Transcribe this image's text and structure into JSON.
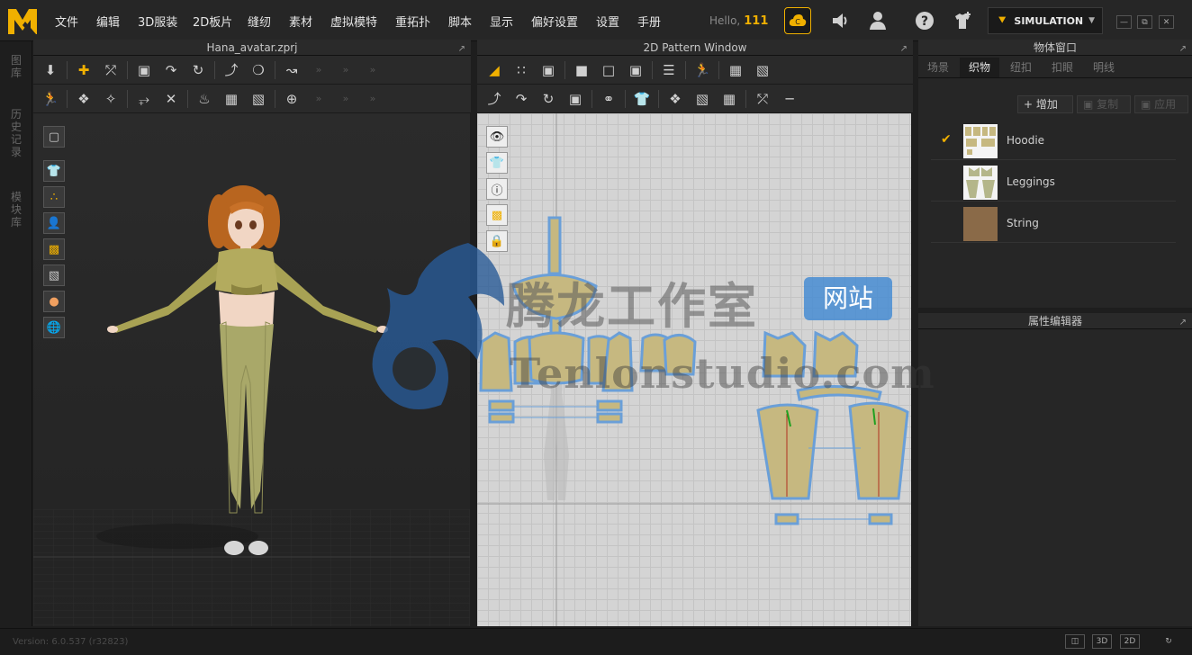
{
  "menubar": {
    "items": [
      "文件",
      "编辑",
      "3D服装",
      "2D板片",
      "缝纫",
      "素材",
      "虚拟模特",
      "重拓扑",
      "脚本",
      "显示",
      "偏好设置",
      "设置",
      "手册"
    ],
    "hello_label": "Hello,",
    "user_points": "111",
    "mode_label": "SIMULATION"
  },
  "side_tabs": [
    "图库",
    "历史记录",
    "模块库"
  ],
  "panels": {
    "view3d_title": "Hana_avatar.zprj",
    "view2d_title": "2D Pattern Window",
    "object_window_title": "物体窗口",
    "property_editor_title": "属性编辑器"
  },
  "object_window": {
    "tabs": [
      "场景",
      "织物",
      "纽扣",
      "扣眼",
      "明线"
    ],
    "active_tab": "织物",
    "buttons": {
      "add": "增加",
      "copy": "复制",
      "apply": "应用"
    },
    "fabrics": [
      {
        "name": "Hoodie",
        "selected": true
      },
      {
        "name": "Leggings",
        "selected": false
      },
      {
        "name": "String",
        "selected": false
      }
    ]
  },
  "status": {
    "version": "Version: 6.0.537 (r32823)",
    "view_buttons": [
      "3D",
      "2D"
    ]
  },
  "watermark": {
    "cn": "腾龙工作室",
    "badge": "网站",
    "en": "Tenlonstudio.com"
  },
  "colors": {
    "accent": "#f0b000",
    "piece_fill": "#c6b880",
    "piece_outline": "#6a9fd8",
    "fabric_brown": "#8a6a48"
  }
}
